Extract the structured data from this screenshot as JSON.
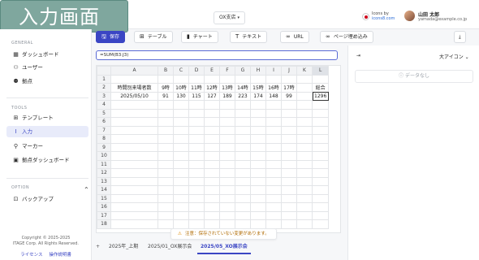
{
  "header": {
    "title_badge": "入力画面",
    "venue_select": "OX支店",
    "icons_by": "Icons by",
    "icons_link": "icons8.com",
    "user_name": "山田 太郎",
    "user_email": "yamada@example.co.jp"
  },
  "sidebar": {
    "general_label": "GENERAL",
    "general_items": [
      {
        "label": "ダッシュボード",
        "icon": "dashboard-icon"
      },
      {
        "label": "ユーザー",
        "icon": "user-add-icon"
      },
      {
        "label": "拠点",
        "icon": "location-users-icon"
      }
    ],
    "tools_label": "TOOLS",
    "tools_items": [
      {
        "label": "テンプレート",
        "icon": "template-icon"
      },
      {
        "label": "入力",
        "icon": "text-cursor-icon",
        "active": true
      },
      {
        "label": "マーカー",
        "icon": "marker-icon"
      },
      {
        "label": "拠点ダッシュボード",
        "icon": "grid-dashboard-icon"
      }
    ],
    "option_label": "OPTION",
    "option_items": [
      {
        "label": "バックアップ",
        "icon": "backup-icon"
      }
    ],
    "copyright_line1": "Copyright © 2025-2025",
    "copyright_line2": "ITAGE Corp. All Rights Reserved.",
    "footer_link_license": "ライセンス",
    "footer_link_manual": "操作説明書"
  },
  "toolbar": {
    "save": "保存",
    "table": "テーブル",
    "chart": "チャート",
    "text": "テキスト",
    "url": "URL",
    "page_embed": "ページ埋め込み"
  },
  "formula_bar": "=SUM(B3:J3)",
  "grid": {
    "columns": [
      "A",
      "B",
      "C",
      "D",
      "E",
      "F",
      "G",
      "H",
      "I",
      "J",
      "K",
      "L"
    ],
    "selected_column": "L",
    "row_count": 18,
    "rows": {
      "2": [
        "時間別来場者数",
        "9時",
        "10時",
        "11時",
        "12時",
        "13時",
        "14時",
        "15時",
        "16時",
        "17時",
        "",
        "総合"
      ],
      "3": [
        "2025/05/10",
        "91",
        "130",
        "115",
        "127",
        "189",
        "223",
        "174",
        "148",
        "99",
        "",
        "1296"
      ]
    }
  },
  "notice": "注意：保存されていない変更があります。",
  "sheet_tabs": {
    "add": "+",
    "tabs": [
      {
        "label": "2025年_上期",
        "active": false
      },
      {
        "label": "2025/01_OX展示会",
        "active": false
      },
      {
        "label": "2025/05_XO展示会",
        "active": true
      }
    ]
  },
  "right_panel": {
    "collapse": "⇥",
    "icon_size": "大アイコン",
    "empty_state": "データなし"
  }
}
